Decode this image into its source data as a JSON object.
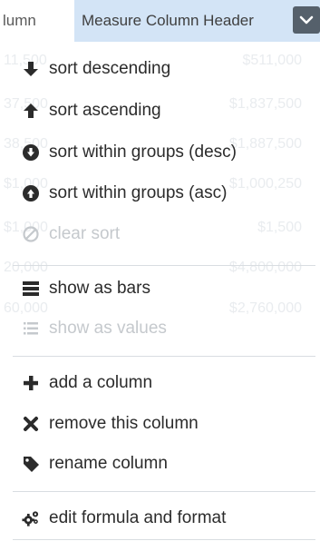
{
  "header": {
    "left_column_label": "lumn",
    "right_column_label": "Measure Column Header",
    "dropdown_icon": "chevron-down-icon"
  },
  "background_rows": [
    {
      "left": "11,500",
      "right": "$511,000"
    },
    {
      "left": "37,500",
      "right": "$1,837,500"
    },
    {
      "left": "38,500",
      "right": "$1,887,500"
    },
    {
      "left": "$1,000",
      "right": "$1,000,250"
    },
    {
      "left": "$1,000",
      "right": "$1,500"
    },
    {
      "left": "20,000",
      "right": "$4,800,000"
    },
    {
      "left": "60,000",
      "right": "$2,760,000"
    }
  ],
  "menu": {
    "sort_descending": {
      "label": "sort descending",
      "icon": "arrow-down-icon"
    },
    "sort_ascending": {
      "label": "sort ascending",
      "icon": "arrow-up-icon"
    },
    "sort_groups_desc": {
      "label": "sort within groups (desc)",
      "icon": "circle-arrow-down-icon"
    },
    "sort_groups_asc": {
      "label": "sort within groups (asc)",
      "icon": "circle-arrow-up-icon"
    },
    "clear_sort": {
      "label": "clear sort",
      "icon": "ban-icon"
    },
    "show_bars": {
      "label": "show as bars",
      "icon": "bars-icon"
    },
    "show_values": {
      "label": "show as values",
      "icon": "list-icon"
    },
    "add_column": {
      "label": "add a column",
      "icon": "plus-icon"
    },
    "remove_column": {
      "label": "remove this column",
      "icon": "x-icon"
    },
    "rename_column": {
      "label": "rename column",
      "icon": "tag-icon"
    },
    "edit_formula": {
      "label": "edit formula and format",
      "icon": "gears-icon"
    }
  },
  "colors": {
    "header_highlight": "#d3e4f6",
    "dropdown_button": "#55606b",
    "icon_dark": "#2b2b2b",
    "disabled": "#c5c9cd"
  }
}
